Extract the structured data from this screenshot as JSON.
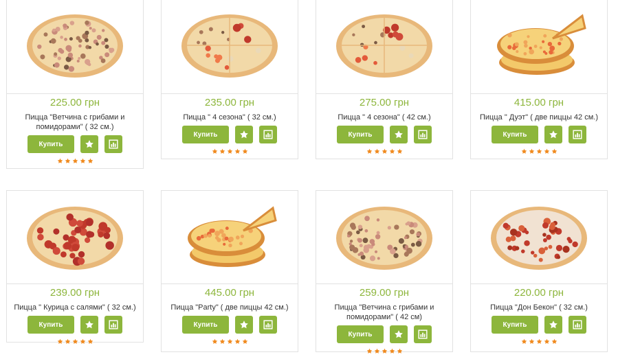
{
  "currency_suffix": "грн",
  "buy_label": "Купить",
  "colors": {
    "accent": "#8db63c",
    "star": "#f08a1e",
    "border": "#e2e2e2"
  },
  "products": [
    {
      "price": "225.00 грн",
      "title": "Пицца \"Ветчина с грибами и помидорами\" ( 32 см.)",
      "rating": 5,
      "image": "pizza-ham-mushroom"
    },
    {
      "price": "235.00 грн",
      "title": "Пицца \" 4 сезона\" ( 32 см.)",
      "rating": 5,
      "image": "pizza-four-seasons"
    },
    {
      "price": "275.00 грн",
      "title": "Пицца \" 4 сезона\" ( 42 см.)",
      "rating": 5,
      "image": "pizza-four-seasons"
    },
    {
      "price": "415.00 грн",
      "title": "Пицца \" Дуэт\" ( две пиццы 42 см.)",
      "rating": 5,
      "image": "pizza-stack"
    },
    {
      "price": "239.00 грн",
      "title": "Пицца \" Курица с салями\" ( 32 см.)",
      "rating": 5,
      "image": "pizza-salami"
    },
    {
      "price": "445.00 грн",
      "title": "Пицца \"Party\" ( две пиццы 42 см.)",
      "rating": 5,
      "image": "pizza-stack"
    },
    {
      "price": "259.00 грн",
      "title": "Пицца \"Ветчина с грибами и помидорами\" ( 42 см)",
      "rating": 5,
      "image": "pizza-ham-mushroom"
    },
    {
      "price": "220.00 грн",
      "title": "Пицца \"Дон Бекон\" ( 32 см.)",
      "rating": 5,
      "image": "pizza-bacon"
    }
  ]
}
